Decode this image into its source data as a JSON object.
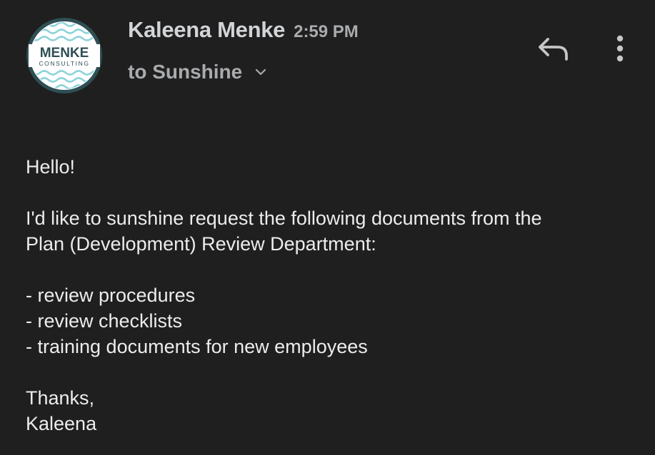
{
  "message": {
    "sender_name": "Kaleena Menke",
    "sent_time": "2:59 PM",
    "recipient_text": "to Sunshine",
    "avatar": {
      "logo_title": "MENKE",
      "logo_subtitle": "CONSULTING",
      "ring_color": "#2f4f55",
      "fill_color": "#ffffff",
      "wave_color": "#8fd3da"
    },
    "actions": {
      "reply_icon": "reply-icon",
      "more_icon": "more-vert-icon",
      "expand_icon": "chevron-down-icon"
    },
    "body": {
      "greeting": "Hello!",
      "request_line_1": "I'd like to sunshine request the following documents from the",
      "request_line_2": "Plan (Development) Review Department:",
      "items": [
        "- review procedures",
        "- review checklists",
        "- training documents for new employees"
      ],
      "closing": "Thanks,",
      "signature": "Kaleena"
    }
  },
  "colors": {
    "background": "#1f1f1f",
    "primary_text": "#ececec",
    "secondary_text": "#a9abae",
    "icon": "#c4c7c5"
  }
}
